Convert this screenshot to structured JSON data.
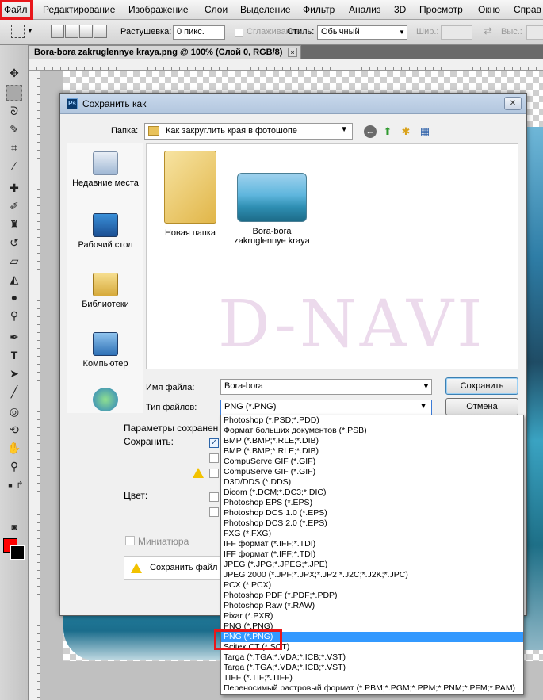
{
  "menubar": {
    "items": [
      "Файл",
      "Редактирование",
      "Изображение",
      "Слои",
      "Выделение",
      "Фильтр",
      "Анализ",
      "3D",
      "Просмотр",
      "Окно",
      "Справ"
    ]
  },
  "options_bar": {
    "feather_label": "Растушевка:",
    "feather_value": "0 пикс.",
    "antialias_label": "Сглаживание",
    "style_label": "Стиль:",
    "style_value": "Обычный",
    "width_label": "Шир.:",
    "height_label": "Выс.:"
  },
  "document_tab": {
    "title": "Bora-bora zakruglennye kraya.png @ 100% (Слой 0, RGB/8)",
    "close": "×"
  },
  "colors": {
    "foreground": "#ff0000",
    "background": "#000000",
    "highlight": "#e8171b",
    "selection": "#3399ff"
  },
  "dialog": {
    "title": "Сохранить как",
    "close": "✕",
    "folder_label": "Папка:",
    "folder_value": "Как закруглить края в фотошопе",
    "places": [
      "Недавние места",
      "Рабочий стол",
      "Библиотеки",
      "Компьютер"
    ],
    "files": [
      {
        "name": "Новая папка",
        "icon": "folder-icon"
      },
      {
        "name": "Bora-bora zakruglennye kraya",
        "icon": "image-thumbnail"
      }
    ],
    "watermark": "D-NAVI",
    "filename_label": "Имя файла:",
    "filename_value": "Bora-bora",
    "filetype_label": "Тип файлов:",
    "filetype_value": "PNG (*.PNG)",
    "save_button": "Сохранить",
    "cancel_button": "Отмена",
    "params_label": "Параметры сохранен",
    "save_label": "Сохранить:",
    "color_label": "Цвет:",
    "thumbnail_label": "Миниатюра",
    "warning_text": "Сохранить файл с"
  },
  "filetype_options": [
    "Photoshop (*.PSD;*.PDD)",
    "Формат больших документов (*.PSB)",
    "BMP (*.BMP;*.RLE;*.DIB)",
    "BMP (*.BMP;*.RLE;*.DIB)",
    "CompuServe GIF (*.GIF)",
    "CompuServe GIF (*.GIF)",
    "D3D/DDS (*.DDS)",
    "Dicom (*.DCM;*.DC3;*.DIC)",
    "Photoshop EPS (*.EPS)",
    "Photoshop DCS 1.0 (*.EPS)",
    "Photoshop DCS 2.0 (*.EPS)",
    "FXG (*.FXG)",
    "IFF формат (*.IFF;*.TDI)",
    "IFF формат (*.IFF;*.TDI)",
    "JPEG (*.JPG;*.JPEG;*.JPE)",
    "JPEG 2000 (*.JPF;*.JPX;*.JP2;*.J2C;*.J2K;*.JPC)",
    "PCX (*.PCX)",
    "Photoshop PDF (*.PDF;*.PDP)",
    "Photoshop Raw (*.RAW)",
    "Pixar (*.PXR)",
    "PNG (*.PNG)",
    "PNG (*.PNG)",
    "Scitex CT (*.SCT)",
    "Targa (*.TGA;*.VDA;*.ICB;*.VST)",
    "Targa (*.TGA;*.VDA;*.ICB;*.VST)",
    "TIFF (*.TIF;*.TIFF)",
    "Переносимый растровый формат (*.PBM;*.PGM;*.PPM;*.PNM;*.PFM;*.PAM)"
  ],
  "filetype_selected_index": 21
}
